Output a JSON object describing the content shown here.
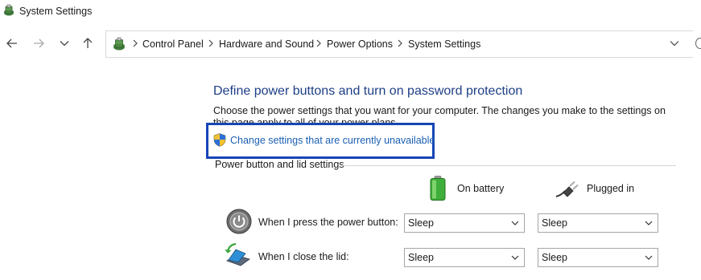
{
  "window": {
    "title": "System Settings",
    "app_icon": "power-options-icon"
  },
  "nav": {
    "back_icon": "arrow-left-icon",
    "forward_icon": "arrow-right-icon",
    "recent_icon": "chevron-down-icon",
    "up_icon": "arrow-up-icon"
  },
  "address_bar": {
    "icon": "power-options-icon",
    "breadcrumbs": [
      "Control Panel",
      "Hardware and Sound",
      "Power Options",
      "System Settings"
    ],
    "dropdown_icon": "chevron-down-icon"
  },
  "content": {
    "heading": "Define power buttons and turn on password protection",
    "description": "Choose the power settings that you want for your computer. The changes you make to the settings on this page apply to all of your power plans.",
    "change_settings_link": "Change settings that are currently unavailable",
    "shield_icon": "uac-shield-icon",
    "highlight_color": "#1646b5",
    "link_color": "#1a5fb4",
    "heading_color": "#1e3f86"
  },
  "power_group": {
    "label": "Power button and lid settings",
    "columns": {
      "battery": {
        "label": "On battery",
        "icon": "battery-icon"
      },
      "plugged": {
        "label": "Plugged in",
        "icon": "power-plug-icon"
      }
    },
    "rows": [
      {
        "label": "When I press the power button:",
        "icon": "power-button-icon",
        "on_battery": "Sleep",
        "plugged_in": "Sleep"
      },
      {
        "label": "When I close the lid:",
        "icon": "laptop-lid-icon",
        "on_battery": "Sleep",
        "plugged_in": "Sleep"
      }
    ]
  }
}
